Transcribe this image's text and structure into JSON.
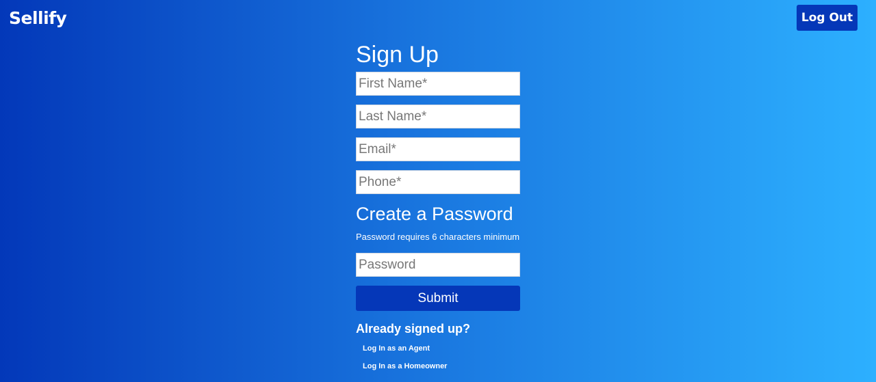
{
  "header": {
    "brand": "Sellify",
    "logout_label": "Log Out"
  },
  "form": {
    "title": "Sign Up",
    "fields": {
      "first_name": {
        "placeholder": "First Name*",
        "value": ""
      },
      "last_name": {
        "placeholder": "Last Name*",
        "value": ""
      },
      "email": {
        "placeholder": "Email*",
        "value": ""
      },
      "phone": {
        "placeholder": "Phone*",
        "value": ""
      }
    },
    "password_section": {
      "title": "Create a Password",
      "hint": "Password requires 6 characters minimum",
      "placeholder": "Password",
      "value": ""
    },
    "submit_label": "Submit"
  },
  "login": {
    "prompt": "Already signed up?",
    "agent_link": "Log In as an Agent",
    "homeowner_link": "Log In as a Homeowner"
  },
  "colors": {
    "gradient_start": "#0338b9",
    "gradient_mid": "#1a78e0",
    "gradient_end": "#2db0ff",
    "button": "#0537b8"
  }
}
